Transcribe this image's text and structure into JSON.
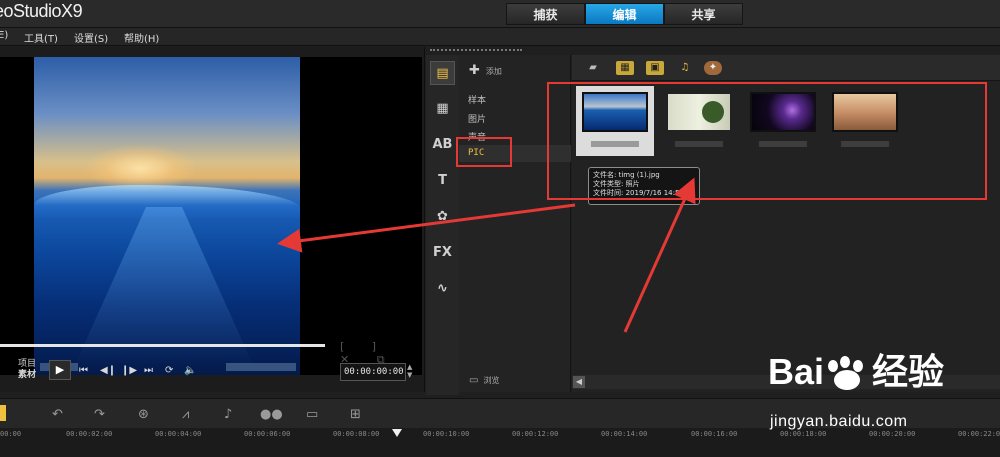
{
  "app": {
    "brand": "eoStudioX9"
  },
  "tabs": [
    {
      "label": "捕获",
      "active": false
    },
    {
      "label": "编辑",
      "active": true
    },
    {
      "label": "共享",
      "active": false
    }
  ],
  "menu": [
    "E)",
    "工具(T)",
    "设置(S)",
    "帮助(H)"
  ],
  "player": {
    "mode_project": "项目",
    "mode_clip": "素材",
    "timecode": "00:00:00:00",
    "play_icon": "▶"
  },
  "library": {
    "add_label": "添加",
    "folders": [
      "样本",
      "图片",
      "声音",
      "PIC"
    ],
    "selected_folder": "PIC",
    "browse_label": "浏览"
  },
  "tooltip": {
    "line1": "文件名: timg (1).jpg",
    "line2": "文件类型: 照片",
    "line3": "文件时间: 2019/7/16 14:52:32"
  },
  "ruler": [
    "00:00",
    "00:00:02:00",
    "00:00:04:00",
    "00:00:06:00",
    "00:00:08:00",
    "00:00:10:00",
    "00:00:12:00",
    "00:00:14:00",
    "00:00:16:00",
    "00:00:18:00",
    "00:00:20:00",
    "00:00:22:00"
  ],
  "watermark": {
    "brand": "Bai",
    "brand_cn": "经验",
    "url": "jingyan.baidu.com"
  },
  "colors": {
    "accent_tab": "#1a8fd6",
    "annotation": "#e53935",
    "selected_folder": "#f0c040"
  }
}
